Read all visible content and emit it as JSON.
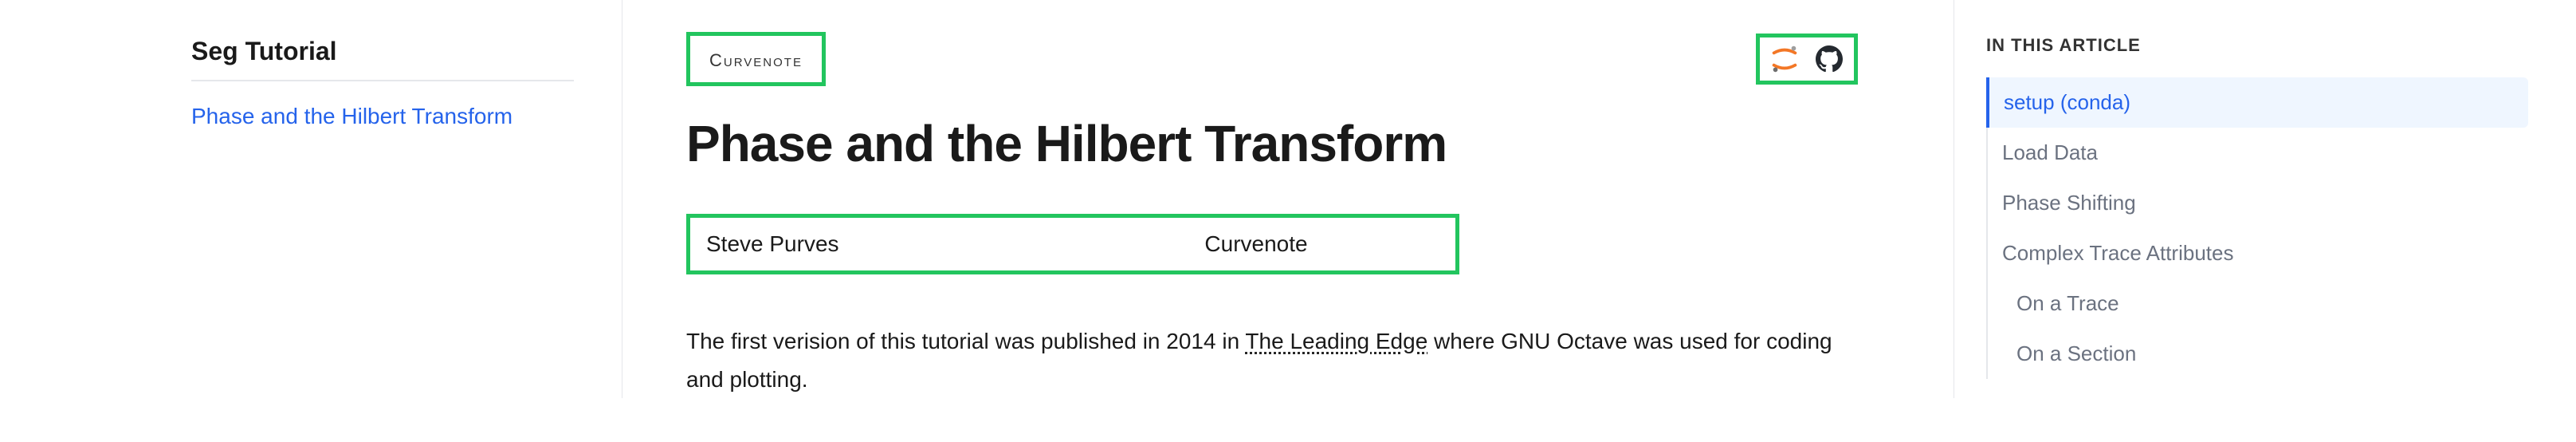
{
  "sidebar": {
    "site_title": "Seg Tutorial",
    "nav_item": "Phase and the Hilbert Transform"
  },
  "header": {
    "kicker": "Curvenote",
    "title": "Phase and the Hilbert Transform",
    "author": "Steve Purves",
    "affiliation": "Curvenote"
  },
  "body": {
    "intro_prefix": "The first verision of this tutorial was published in 2014 in ",
    "intro_link": "The Leading Edge",
    "intro_suffix": " where GNU Octave was used for coding and plotting."
  },
  "toc": {
    "heading": "IN THIS ARTICLE",
    "items": [
      {
        "label": "setup (conda)",
        "level": 0,
        "active": true
      },
      {
        "label": "Load Data",
        "level": 0,
        "active": false
      },
      {
        "label": "Phase Shifting",
        "level": 0,
        "active": false
      },
      {
        "label": "Complex Trace Attributes",
        "level": 0,
        "active": false
      },
      {
        "label": "On a Trace",
        "level": 1,
        "active": false
      },
      {
        "label": "On a Section",
        "level": 1,
        "active": false
      }
    ]
  }
}
